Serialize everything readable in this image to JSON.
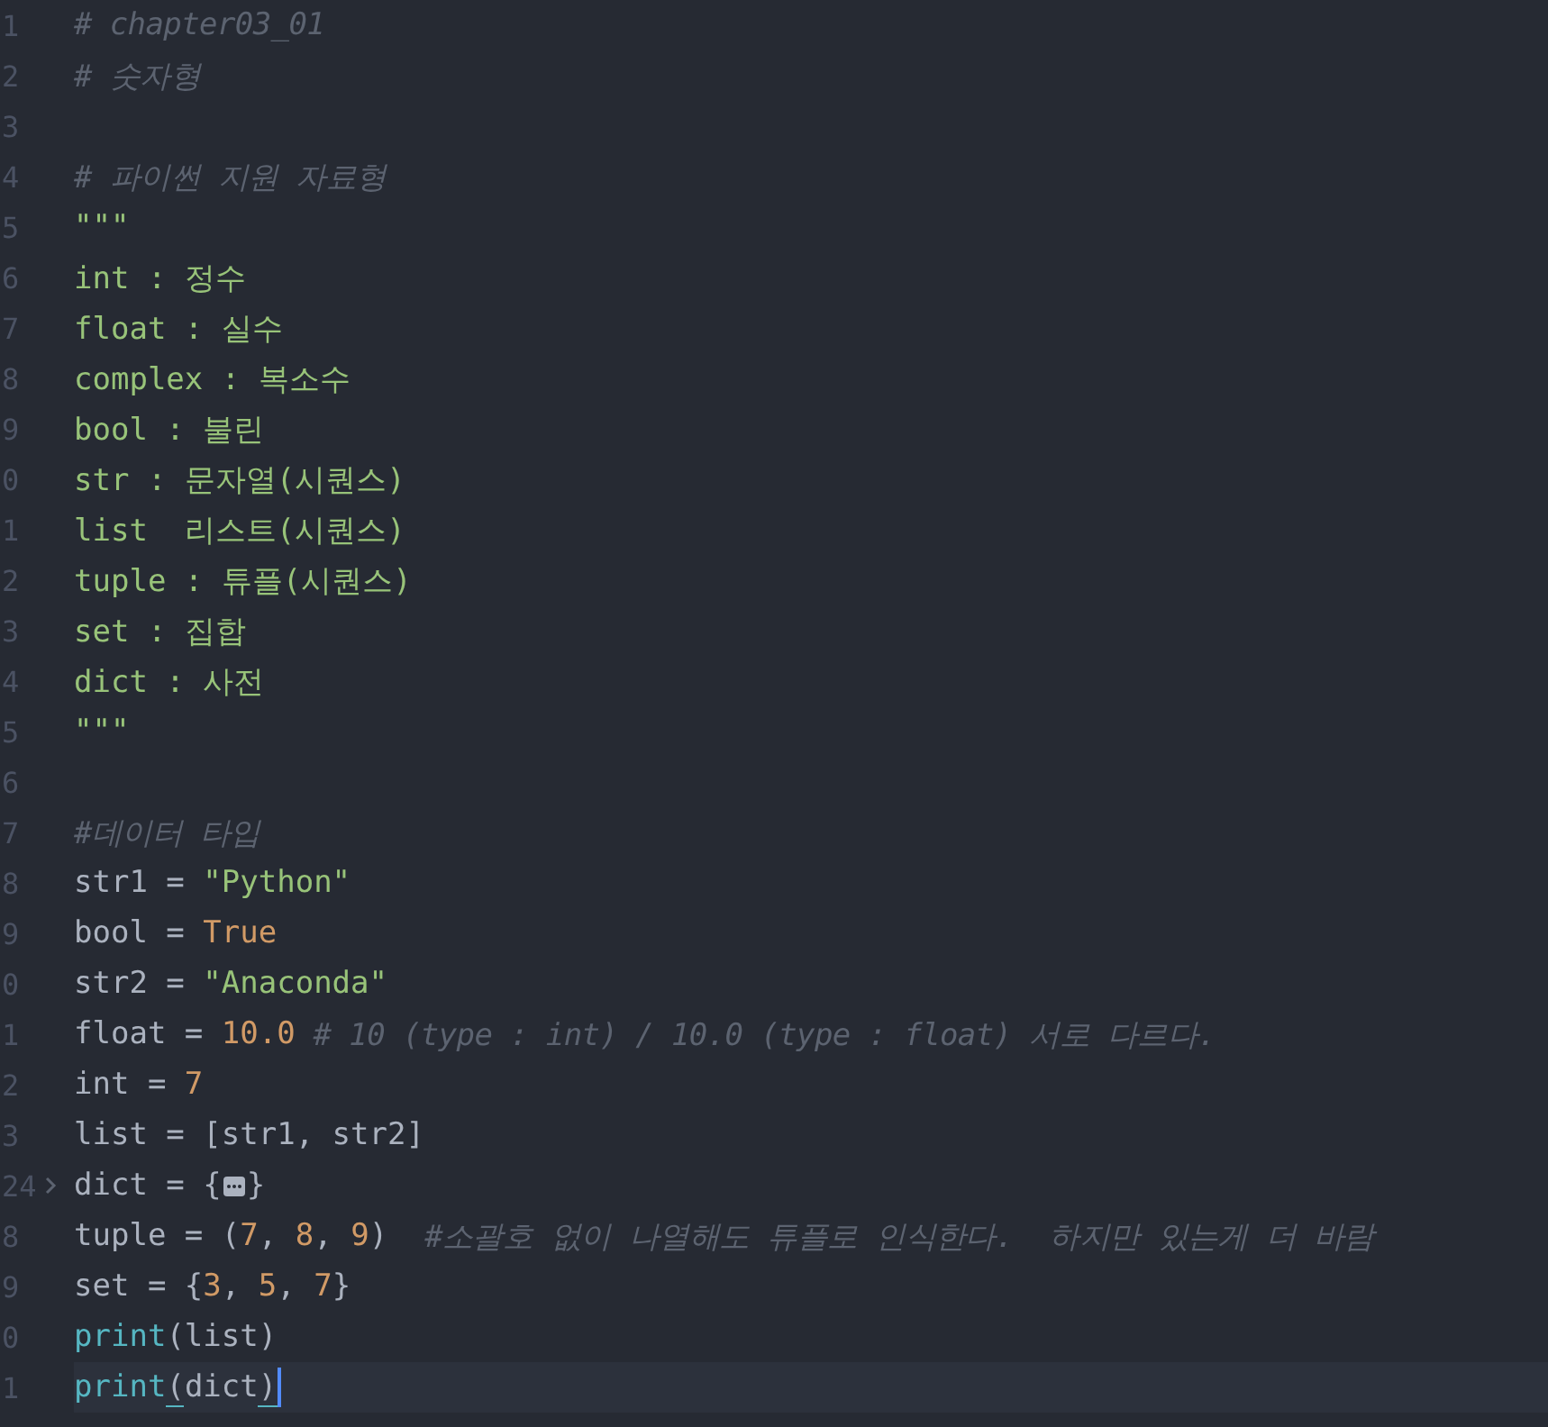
{
  "editor": {
    "lines": [
      {
        "number": "1",
        "tokens": [
          {
            "kind": "comment",
            "text": "# chapter03_01"
          }
        ]
      },
      {
        "number": "2",
        "tokens": [
          {
            "kind": "comment",
            "text": "# 숫자형"
          }
        ]
      },
      {
        "number": "3"
      },
      {
        "number": "4",
        "tokens": [
          {
            "kind": "comment",
            "text": "# 파이썬 지원 자료형"
          }
        ]
      },
      {
        "number": "5",
        "tokens": [
          {
            "kind": "docstring",
            "text": "\"\"\""
          }
        ]
      },
      {
        "number": "6",
        "tokens": [
          {
            "kind": "docstring",
            "text": "int : 정수"
          }
        ]
      },
      {
        "number": "7",
        "tokens": [
          {
            "kind": "docstring",
            "text": "float : 실수"
          }
        ]
      },
      {
        "number": "8",
        "tokens": [
          {
            "kind": "docstring",
            "text": "complex : 복소수"
          }
        ]
      },
      {
        "number": "9",
        "tokens": [
          {
            "kind": "docstring",
            "text": "bool : 불린"
          }
        ]
      },
      {
        "number": "0",
        "tokens": [
          {
            "kind": "docstring",
            "text": "str : 문자열(시퀀스)"
          }
        ]
      },
      {
        "number": "1",
        "tokens": [
          {
            "kind": "docstring",
            "text": "list  리스트(시퀀스)"
          }
        ]
      },
      {
        "number": "2",
        "tokens": [
          {
            "kind": "docstring",
            "text": "tuple : 튜플(시퀀스)"
          }
        ]
      },
      {
        "number": "3",
        "tokens": [
          {
            "kind": "docstring",
            "text": "set : 집합"
          }
        ]
      },
      {
        "number": "4",
        "tokens": [
          {
            "kind": "docstring",
            "text": "dict : 사전"
          }
        ]
      },
      {
        "number": "5",
        "tokens": [
          {
            "kind": "docstring",
            "text": "\"\"\""
          }
        ]
      },
      {
        "number": "6"
      },
      {
        "number": "7",
        "tokens": [
          {
            "kind": "comment",
            "text": "#데이터 타입"
          }
        ]
      },
      {
        "number": "8",
        "tokens": [
          {
            "kind": "plain",
            "text": "str1 = "
          },
          {
            "kind": "string",
            "text": "\"Python\""
          }
        ]
      },
      {
        "number": "9",
        "tokens": [
          {
            "kind": "plain",
            "text": "bool = "
          },
          {
            "kind": "constant",
            "text": "True"
          }
        ]
      },
      {
        "number": "0",
        "tokens": [
          {
            "kind": "plain",
            "text": "str2 = "
          },
          {
            "kind": "string",
            "text": "\"Anaconda\""
          }
        ]
      },
      {
        "number": "1",
        "tokens": [
          {
            "kind": "plain",
            "text": "float = "
          },
          {
            "kind": "number",
            "text": "10.0"
          },
          {
            "kind": "comment",
            "text": " # 10 (type : int) / 10.0 (type : float) 서로 다르다."
          }
        ]
      },
      {
        "number": "2",
        "tokens": [
          {
            "kind": "plain",
            "text": "int = "
          },
          {
            "kind": "number",
            "text": "7"
          }
        ]
      },
      {
        "number": "3",
        "tokens": [
          {
            "kind": "plain",
            "text": "list = [str1, str2]"
          }
        ]
      },
      {
        "number": "24",
        "folded": true,
        "tokens": [
          {
            "kind": "plain",
            "text": "dict = {"
          },
          {
            "kind": "fold"
          },
          {
            "kind": "plain",
            "text": "}"
          }
        ]
      },
      {
        "number": "8",
        "tokens": [
          {
            "kind": "plain",
            "text": "tuple = ("
          },
          {
            "kind": "number",
            "text": "7"
          },
          {
            "kind": "plain",
            "text": ", "
          },
          {
            "kind": "number",
            "text": "8"
          },
          {
            "kind": "plain",
            "text": ", "
          },
          {
            "kind": "number",
            "text": "9"
          },
          {
            "kind": "plain",
            "text": ")  "
          },
          {
            "kind": "comment",
            "text": "#소괄호 없이 나열해도 튜플로 인식한다.  하지만 있는게 더 바람"
          }
        ]
      },
      {
        "number": "9",
        "tokens": [
          {
            "kind": "plain",
            "text": "set = {"
          },
          {
            "kind": "number",
            "text": "3"
          },
          {
            "kind": "plain",
            "text": ", "
          },
          {
            "kind": "number",
            "text": "5"
          },
          {
            "kind": "plain",
            "text": ", "
          },
          {
            "kind": "number",
            "text": "7"
          },
          {
            "kind": "plain",
            "text": "}"
          }
        ]
      },
      {
        "number": "0",
        "tokens": [
          {
            "kind": "builtin",
            "text": "print"
          },
          {
            "kind": "plain",
            "text": "(list)"
          }
        ]
      },
      {
        "number": "1",
        "current": true,
        "tokens": [
          {
            "kind": "builtin",
            "text": "print"
          },
          {
            "kind": "match",
            "text": "("
          },
          {
            "kind": "plain",
            "text": "dict"
          },
          {
            "kind": "match",
            "text": ")"
          }
        ]
      }
    ]
  }
}
